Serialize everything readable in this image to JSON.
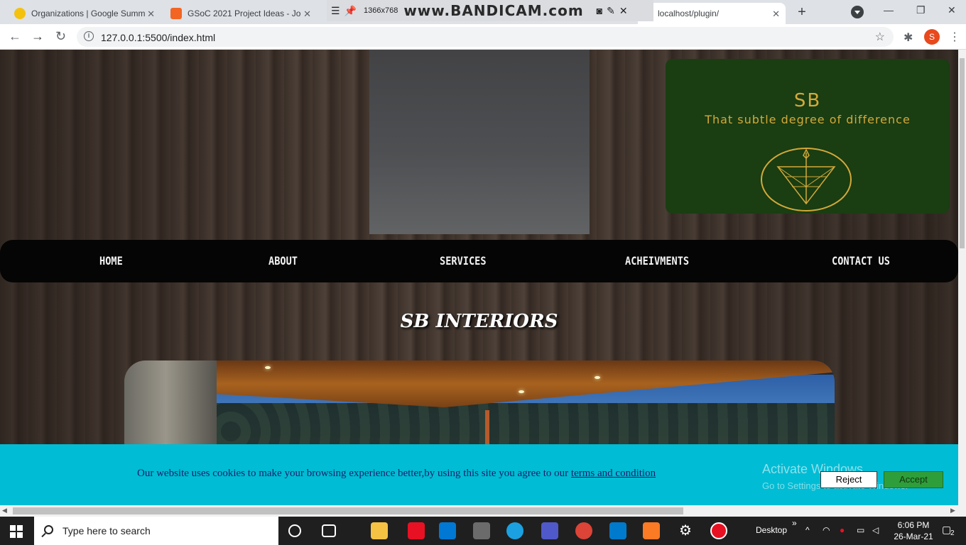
{
  "browser": {
    "tabs": [
      {
        "title": "Organizations | Google Summ",
        "close": "✕"
      },
      {
        "title": "GSoC 2021 Project Ideas - Jo",
        "close": "✕"
      },
      {
        "title": "localhost/plugin/",
        "close": "✕"
      }
    ],
    "new_tab": "+",
    "url": "127.0.0.1:5500/index.html",
    "profile_initial": "S",
    "back": "←",
    "forward": "→",
    "reload": "↻",
    "star": "☆",
    "extensions": "✱",
    "menu": "⋮",
    "min": "—",
    "max": "❐",
    "close": "✕"
  },
  "recorder": {
    "resolution": "1366x768",
    "watermark": "www.BANDICAM.com"
  },
  "site": {
    "logo": {
      "initials": "SB",
      "tagline": "That subtle degree of difference",
      "color": "#d3a93a"
    },
    "nav": [
      "HOME",
      "ABOUT",
      "SERVICES",
      "ACHEIVMENTS",
      "CONTACT US"
    ],
    "title": "SB INTERIORS"
  },
  "cookie": {
    "message": "Our website uses cookies to make your browsing experience better,by using this site you agree to our ",
    "link": "terms and condition",
    "reject": "Reject",
    "accept": "Accept",
    "bg_color": "#00bcd4"
  },
  "watermark": {
    "title": "Activate Windows",
    "subtitle": "Go to Settings to activate Windows."
  },
  "taskbar": {
    "search_placeholder": "Type here to search",
    "desktop_label": "Desktop",
    "time": "6:06 PM",
    "date": "26-Mar-21",
    "notification_count": "2",
    "chevron": "»",
    "tray_up": "^"
  }
}
